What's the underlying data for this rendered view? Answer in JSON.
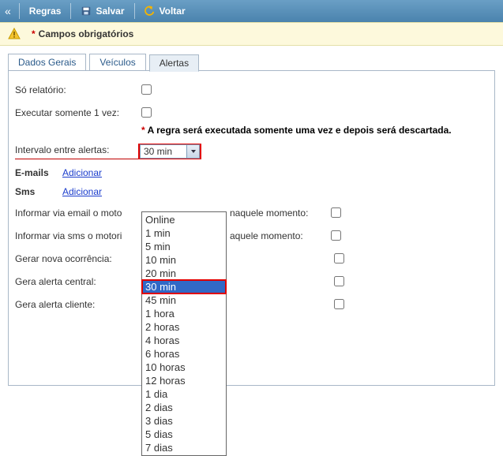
{
  "toolbar": {
    "regras": "Regras",
    "salvar": "Salvar",
    "voltar": "Voltar"
  },
  "infobar": {
    "asterisk": "*",
    "text": "Campos obrigatórios"
  },
  "tabs": {
    "dados": "Dados Gerais",
    "veiculos": "Veículos",
    "alertas": "Alertas"
  },
  "form": {
    "so_relatorio": "Só relatório:",
    "executar": "Executar somente 1 vez:",
    "note_ast": "*",
    "note": "A regra será executada somente uma vez e depois será descartada.",
    "intervalo": "Intervalo entre alertas:",
    "intervalo_value": "30 min",
    "emails_lbl": "E-mails",
    "sms_lbl": "Sms",
    "adicionar": "Adicionar",
    "inf_email": "Informar via email o motorista do veículo naquele momento:",
    "inf_email_cut": "Informar via email o moto",
    "inf_email_tail": "naquele momento:",
    "inf_sms": "Informar via sms o motorista do veículo naquele momento:",
    "inf_sms_cut": "Informar via sms o motori",
    "inf_sms_tail": "aquele momento:",
    "gerar_ocorr": "Gerar nova ocorrência:",
    "gera_central": "Gera alerta central:",
    "gera_cliente": "Gera alerta cliente:"
  },
  "dropdown": {
    "options": [
      "Online",
      "1 min",
      "5 min",
      "10 min",
      "20 min",
      "30 min",
      "45 min",
      "1 hora",
      "2 horas",
      "4 horas",
      "6 horas",
      "10 horas",
      "12 horas",
      "1 dia",
      "2 dias",
      "3 dias",
      "5 dias",
      "7 dias"
    ],
    "selected": "30 min"
  }
}
